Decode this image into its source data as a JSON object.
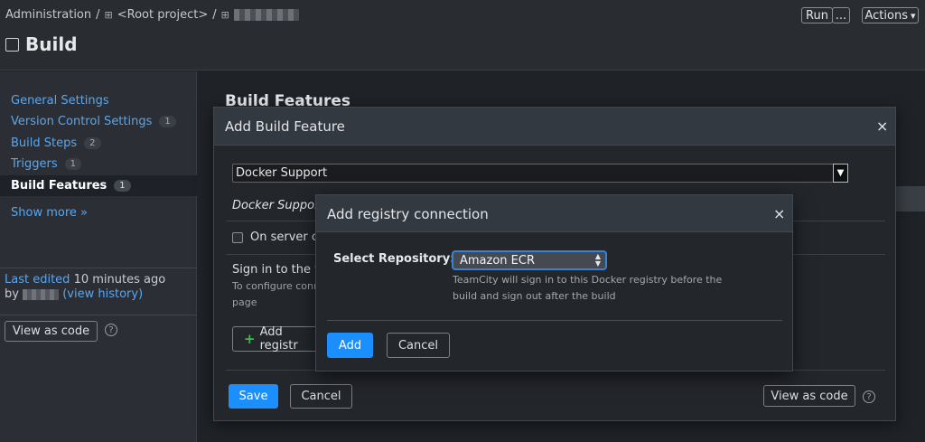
{
  "breadcrumb": {
    "admin": "Administration",
    "sep": "/",
    "root_project": "<Root project>"
  },
  "page": {
    "title": "Build"
  },
  "toolbar": {
    "run": "Run",
    "more": "...",
    "actions": "Actions"
  },
  "sidebar": {
    "items": [
      {
        "label": "General Settings",
        "count": ""
      },
      {
        "label": "Version Control Settings",
        "count": "1"
      },
      {
        "label": "Build Steps",
        "count": "2"
      },
      {
        "label": "Triggers",
        "count": "1"
      },
      {
        "label": "Build Features",
        "count": "1",
        "active": true
      }
    ],
    "show_more": "Show more »",
    "last_edited_prefix": "Last edited",
    "last_edited_time": "10 minutes ago",
    "by": "by",
    "view_history": "(view history)",
    "view_as_code": "View as code"
  },
  "main": {
    "heading": "Build Features"
  },
  "add_feature_dialog": {
    "title": "Add Build Feature",
    "selected_feature": "Docker Support",
    "feature_label": "Docker Support",
    "checkbox_label": "On server cl",
    "sign_in": "Sign in to the fo",
    "hint_line1": "To configure conn",
    "hint_line2": "page",
    "add_registry": "Add registr",
    "save": "Save",
    "cancel": "Cancel",
    "view_as_code": "View as code"
  },
  "registry_dialog": {
    "title": "Add registry connection",
    "select_label": "Select Repository:",
    "selected_repository": "Amazon ECR",
    "hint": "TeamCity will sign in to this Docker registry before the build and sign out after the build",
    "add": "Add",
    "cancel": "Cancel"
  },
  "icons": {
    "close": "×",
    "help": "?",
    "grid": "⊞",
    "dropdown": "▼",
    "caret": "▾"
  },
  "colors": {
    "link": "#5aa6ec",
    "primary": "#1c8fff",
    "add_plus": "#3fb950"
  }
}
